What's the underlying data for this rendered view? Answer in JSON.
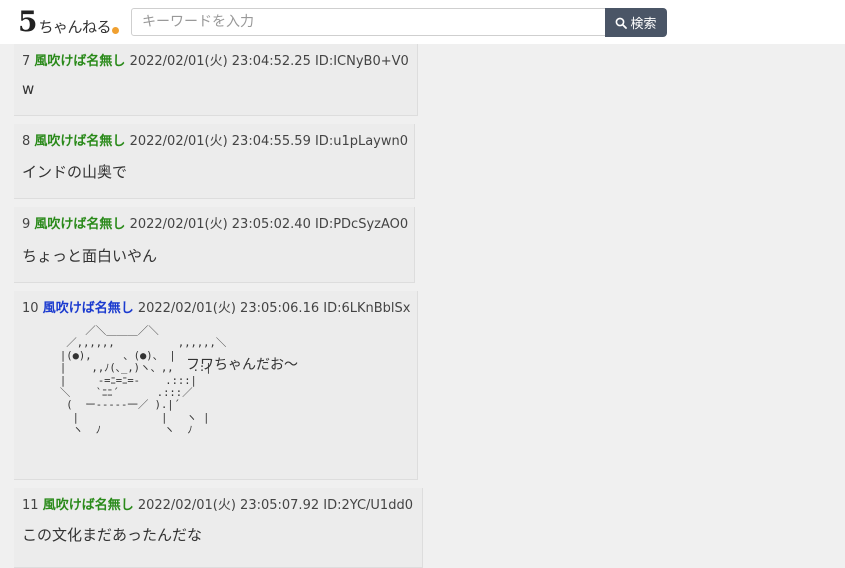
{
  "header": {
    "logo_text_number": "5",
    "logo_text_word": "ちゃんねる",
    "search_placeholder": "キーワードを入力",
    "search_button_label": "検索"
  },
  "posts": [
    {
      "num": "7",
      "name": "風吹けば名無し",
      "meta": "2022/02/01(火) 23:04:52.25 ID:ICNyB0+V0",
      "body": "w"
    },
    {
      "num": "8",
      "name": "風吹けば名無し",
      "meta": "2022/02/01(火) 23:04:55.59 ID:u1pLaywn0",
      "body": "インドの山奥で"
    },
    {
      "num": "9",
      "name": "風吹けば名無し",
      "meta": "2022/02/01(火) 23:05:02.40 ID:PDcSyzAO0",
      "body": "ちょっと面白いやん"
    },
    {
      "num": "10",
      "name": "風吹けば名無し",
      "meta": "2022/02/01(火) 23:05:06.16 ID:6LKnBblSx",
      "ascii_art": "          ／＼＿＿＿／＼\n       ／,,,,,,          ,,,,,,＼\n      |(●),     、(●)、 |\n      |    ,,ﾉ(､_,)ヽ、,,   .:|\n      |     -=ﾆ=ﾆ=-    .:::|\n      ＼    `ﾆﾆ´      .:::／\n       (  ー‐‐‐‐‐一／ ).|´\n        |             |   ヽ |\n        ヽ  ﾉ          ヽ  ﾉ",
      "body": "フワちゃんだお～"
    },
    {
      "num": "11",
      "name": "風吹けば名無し",
      "meta": "2022/02/01(火) 23:05:07.92 ID:2YC/U1dd0",
      "body": "この文化まだあったんだな"
    }
  ]
}
